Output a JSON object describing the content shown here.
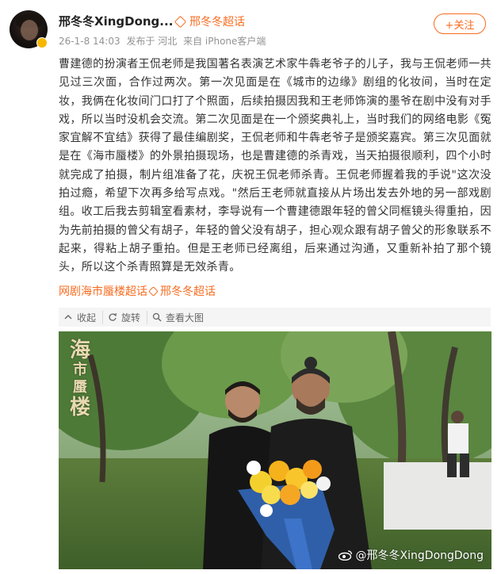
{
  "post": {
    "author": "邢冬冬XingDong...",
    "super_topic": "邢冬冬超话",
    "timestamp": "26-1-8 14:03",
    "posted_from": "发布于 河北",
    "client": "来自 iPhone客户端",
    "follow_label": "+关注",
    "content": "曹建德的扮演者王侃老师是我国著名表演艺术家牛犇老爷子的儿子，我与王侃老师一共见过三次面，合作过两次。第一次见面是在《城市的边缘》剧组的化妆间，当时在定妆，我俩在化妆间门口打了个照面，后续拍摄因我和王老师饰演的墨爷在剧中没有对手戏，所以当时没机会交流。第二次见面是在一个颁奖典礼上，当时我们的网络电影《冤家宜解不宜结》获得了最佳编剧奖，王侃老师和牛犇老爷子是颁奖嘉宾。第三次见面就是在《海市蜃楼》的外景拍摄现场，也是曹建德的杀青戏，当天拍摄很顺利，四个小时就完成了拍摄，制片组准备了花，庆祝王侃老师杀青。王侃老师握着我的手说\"这次没拍过瘾，希望下次再多给写点戏。\"然后王老师就直接从片场出发去外地的另一部戏剧组。收工后我去剪辑室看素材，李导说有一个曹建德跟年轻的曾父同框镜头得重拍，因为先前拍摄的曾父有胡子，年轻的曾父没有胡子，担心观众跟有胡子曾父的形象联系不起来，得粘上胡子重拍。但是王老师已经离组，后来通过沟通，又重新补拍了那个镜头，所以这个杀青照算是无效杀青。",
    "tags": [
      "网剧海市蜃楼超话",
      "邢冬冬超话"
    ]
  },
  "toolbar": {
    "collect_label": "收起",
    "rotate_label": "旋转",
    "view_large_label": "查看大图"
  },
  "photo": {
    "title_chars": [
      "海",
      "市",
      "蜃",
      "楼"
    ],
    "watermark": "@邢冬冬XingDongDong"
  },
  "colors": {
    "accent": "#f86b1f",
    "meta_text": "#939393",
    "toolbar_bg": "#f5f5f5"
  }
}
